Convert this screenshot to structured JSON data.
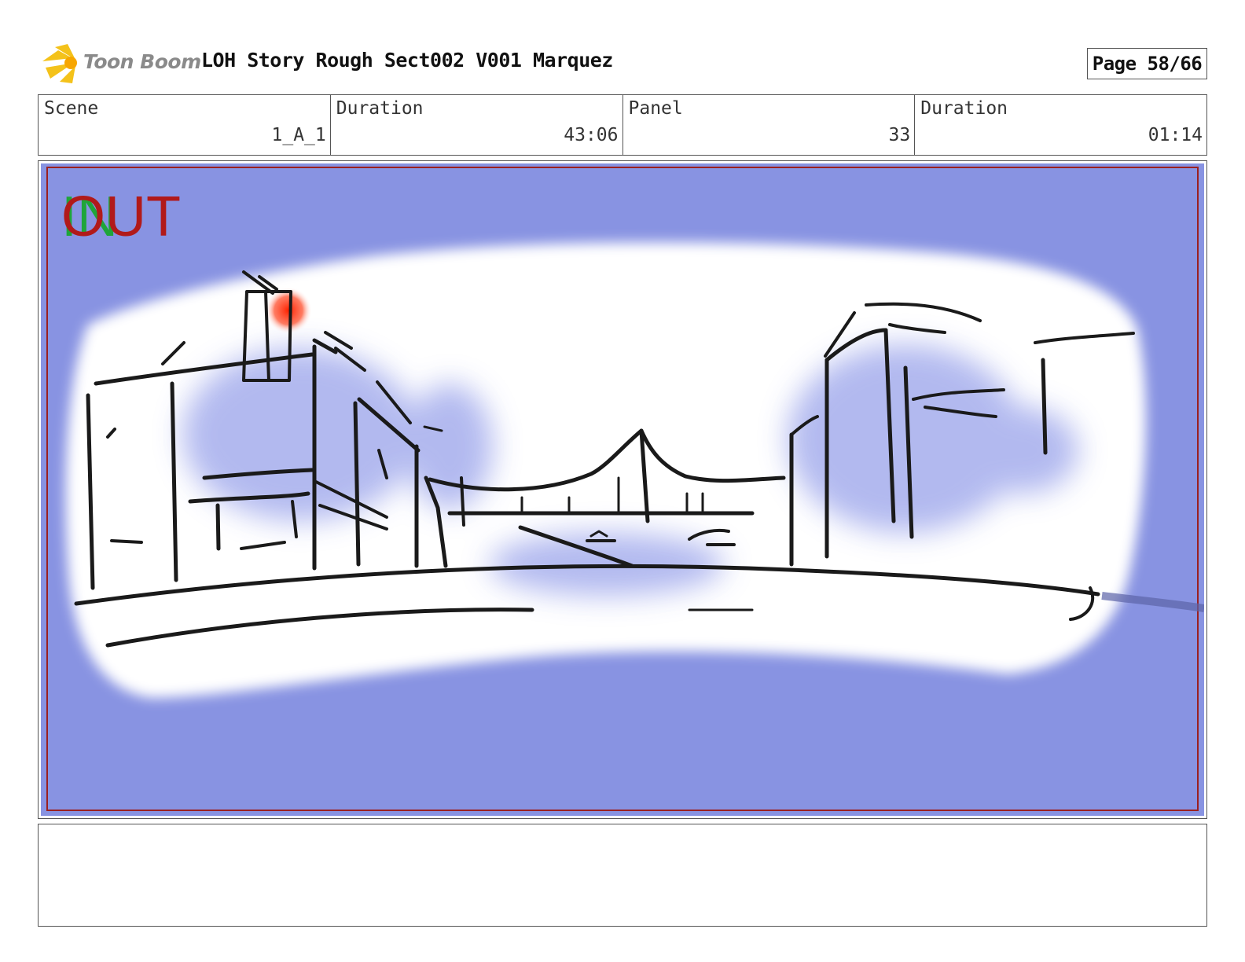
{
  "header": {
    "logo_text": "Toon Boom",
    "title": "LOH Story Rough Sect002 V001 Marquez",
    "page_label": "Page 58/66"
  },
  "info": {
    "scene_label": "Scene",
    "scene_value": "1_A_1",
    "scene_duration_label": "Duration",
    "scene_duration_value": "43:06",
    "panel_label": "Panel",
    "panel_value": "33",
    "panel_duration_label": "Duration",
    "panel_duration_value": "01:14"
  },
  "panel_image": {
    "marker_in": "IN",
    "marker_out": "OUT",
    "background_color": "#8893e2",
    "in_color": "#1fa53a",
    "out_color": "#b11a1a"
  },
  "notes": {
    "text": ""
  }
}
